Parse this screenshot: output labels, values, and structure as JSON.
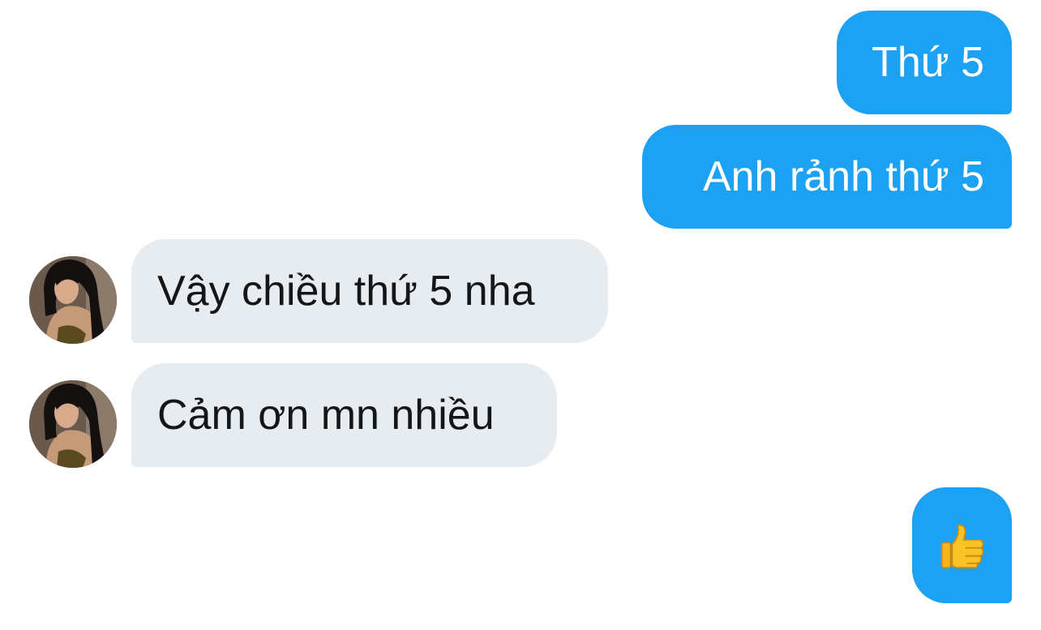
{
  "conversation": {
    "messages": [
      {
        "sender": "me",
        "text": "Thứ 5"
      },
      {
        "sender": "me",
        "text": "Anh rảnh thứ 5"
      },
      {
        "sender": "contact",
        "text": "Vậy chiều thứ 5 nha",
        "avatar": "contact-avatar"
      },
      {
        "sender": "contact",
        "text": "Cảm ơn mn nhiều",
        "avatar": "contact-avatar"
      },
      {
        "sender": "me",
        "text": "",
        "icon": "thumbs-up-icon"
      }
    ]
  },
  "colors": {
    "sent_bubble": "#1da1f2",
    "received_bubble": "#e6ecf0",
    "sent_text": "#ffffff",
    "received_text": "#14171a",
    "thumb": "#f7c325"
  }
}
